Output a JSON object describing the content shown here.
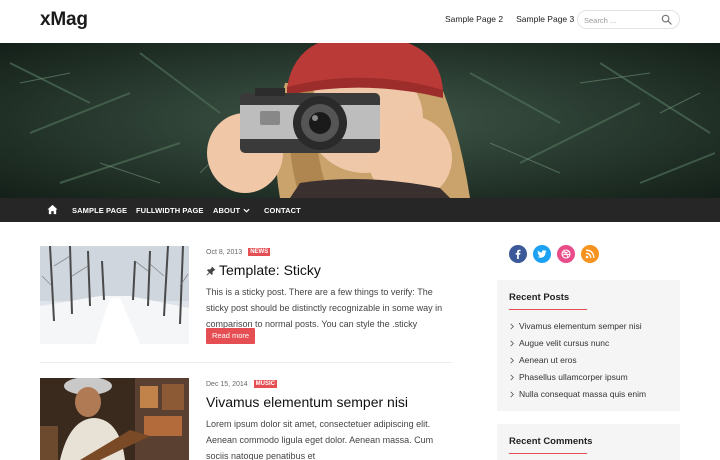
{
  "header": {
    "logo": "xMag",
    "top_nav": [
      "Sample Page 2",
      "Sample Page 3"
    ],
    "search_placeholder": "Search ..."
  },
  "main_nav": {
    "items": [
      "SAMPLE PAGE",
      "FULLWIDTH PAGE",
      "ABOUT",
      "CONTACT"
    ]
  },
  "posts": [
    {
      "date": "Oct 8, 2013",
      "category": "NEWS",
      "title": "Template: Sticky",
      "excerpt": "This is a sticky post. There are a few things to verify: The sticky post should be distinctly recognizable in some way in comparison to normal posts. You can style the .sticky",
      "read_more": "Read more"
    },
    {
      "date": "Dec 15, 2014",
      "category": "MUSIC",
      "title": "Vivamus elementum semper nisi",
      "excerpt": "Lorem ipsum dolor sit amet, consectetuer adipiscing elit. Aenean commodo ligula eget dolor. Aenean massa. Cum sociis natoque penatibus et"
    }
  ],
  "social": [
    "facebook-icon",
    "twitter-icon",
    "dribbble-icon",
    "rss-icon"
  ],
  "colors": {
    "accent": "#e54e53",
    "nav_bg": "#262626",
    "facebook": "#3b5998",
    "twitter": "#1da1f2",
    "dribbble": "#ea4c89",
    "rss": "#f7931e"
  },
  "sidebar": {
    "recent_posts": {
      "title": "Recent Posts",
      "items": [
        "Vivamus elementum semper nisi",
        "Augue velit cursus nunc",
        "Aenean ut eros",
        "Phasellus ullamcorper ipsum",
        "Nulla consequat massa quis enim"
      ]
    },
    "recent_comments": {
      "title": "Recent Comments"
    }
  }
}
